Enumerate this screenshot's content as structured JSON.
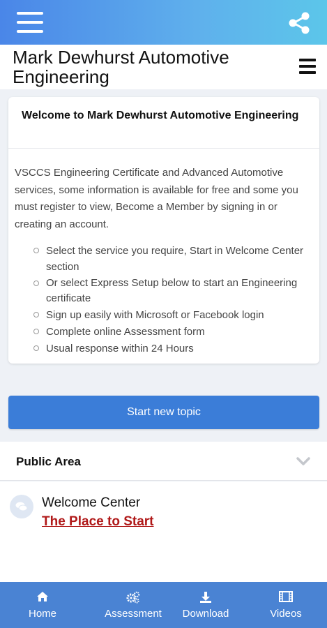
{
  "topbar": {
    "menu_icon": "hamburger-icon",
    "share_icon": "share-icon"
  },
  "header": {
    "title": "Mark Dewhurst Automotive Engineering",
    "menu_icon": "menu-icon"
  },
  "welcome_card": {
    "title": "Welcome to Mark Dewhurst Automotive Engineering",
    "intro": "VSCCS Engineering Certificate and Advanced Automotive services, some information is available for free and some you must register to view,  Become a Member by signing in or creating an account.",
    "bullets": [
      "Select the service you require, Start in Welcome Center section",
      "Or select Express Setup below to start an Engineering certificate",
      "Sign up easily with Microsoft or Facebook login",
      "Complete online Assessment form",
      "Usual response within 24 Hours"
    ]
  },
  "actions": {
    "start_topic": "Start new topic"
  },
  "public_area": {
    "title": "Public Area",
    "topic": {
      "name": "Welcome Center",
      "link": "The Place to Start"
    }
  },
  "bottom_nav": [
    {
      "label": "Home",
      "icon": "home-icon"
    },
    {
      "label": "Assessment",
      "icon": "cogs-icon"
    },
    {
      "label": "Download",
      "icon": "download-icon"
    },
    {
      "label": "Videos",
      "icon": "film-icon"
    }
  ],
  "colors": {
    "accent": "#3b7dd8",
    "link": "#b01919",
    "nav": "#4a83d3"
  }
}
